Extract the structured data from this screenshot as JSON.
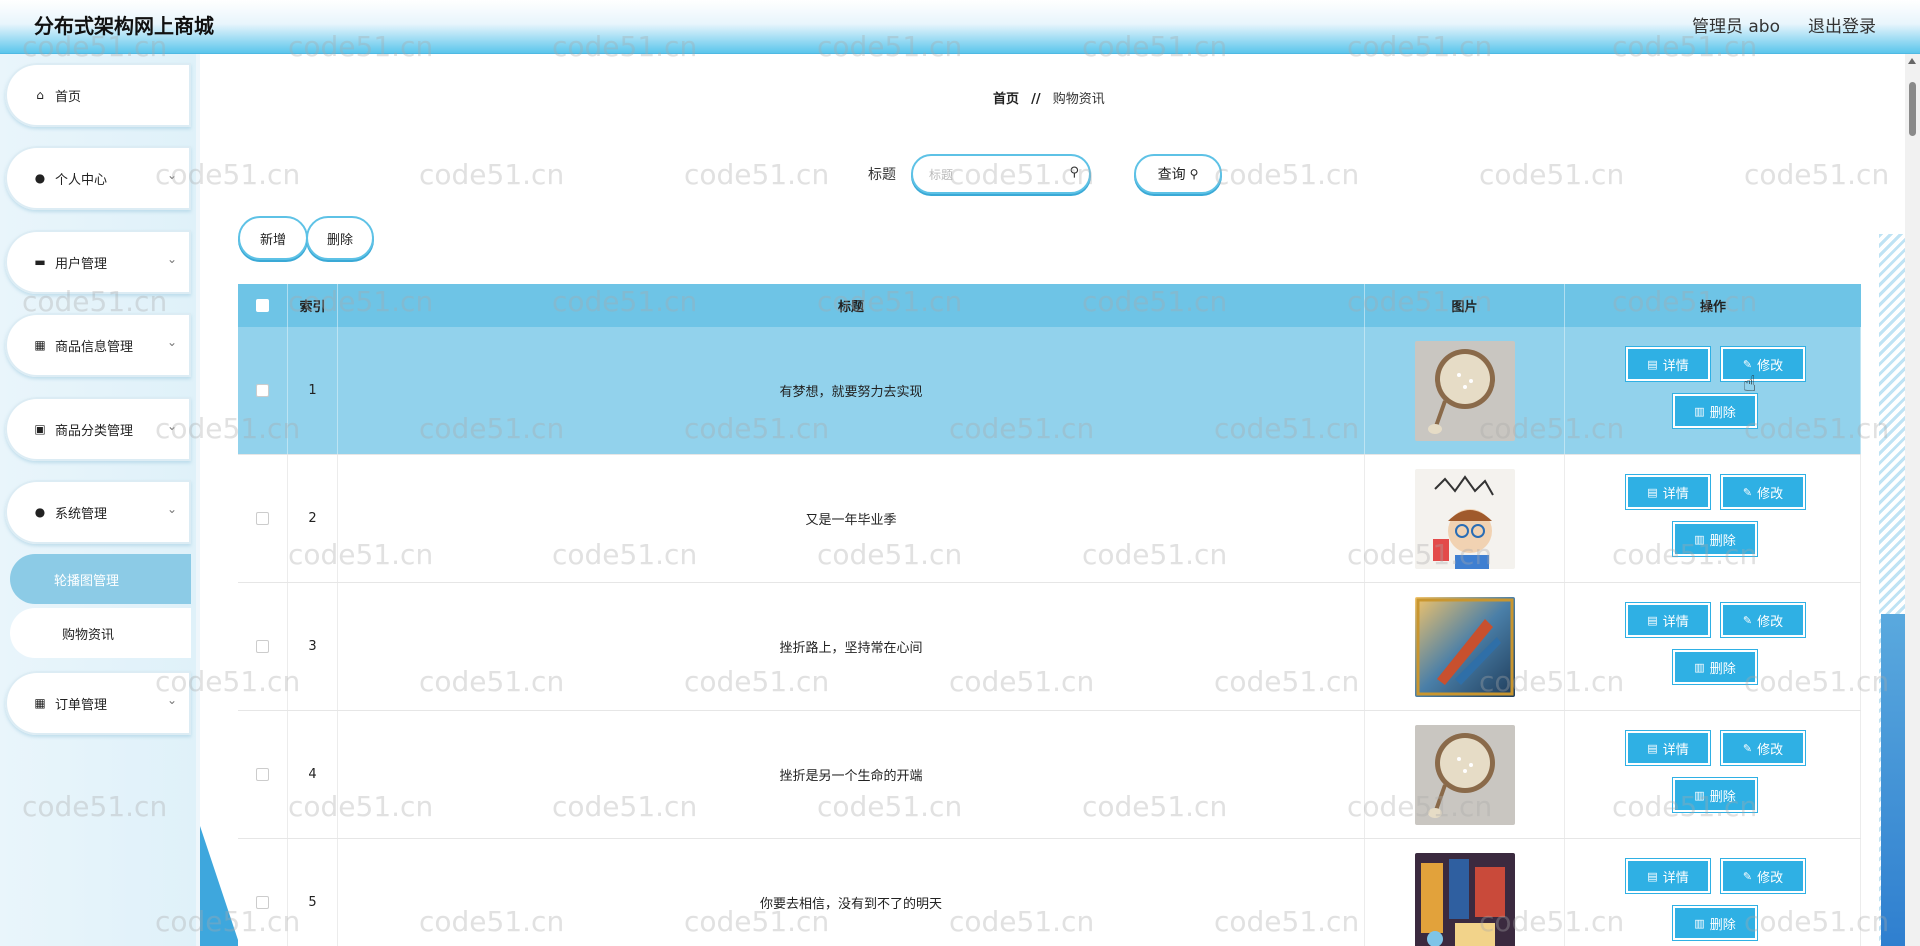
{
  "app": {
    "title": "分布式架构网上商城",
    "user": "管理员 abo",
    "logout": "退出登录"
  },
  "sidebar": {
    "items": [
      {
        "label": "首页",
        "icon": "home-icon",
        "glyph": "⌂"
      },
      {
        "label": "个人中心",
        "icon": "person-icon",
        "glyph": "●"
      },
      {
        "label": "用户管理",
        "icon": "user-manage-icon",
        "glyph": "▬"
      },
      {
        "label": "商品信息管理",
        "icon": "grid-icon",
        "glyph": "▦"
      },
      {
        "label": "商品分类管理",
        "icon": "clipboard-icon",
        "glyph": "▣"
      },
      {
        "label": "系统管理",
        "icon": "person-icon",
        "glyph": "●"
      },
      {
        "label": "订单管理",
        "icon": "grid-icon",
        "glyph": "▦"
      }
    ],
    "subitems": [
      "轮播图管理",
      "购物资讯"
    ]
  },
  "breadcrumb": {
    "home": "首页",
    "sep": "//",
    "current": "购物资讯"
  },
  "search": {
    "label": "标题",
    "placeholder": "标题",
    "query_label": "查询"
  },
  "actions": {
    "add": "新增",
    "delete": "删除"
  },
  "table": {
    "headers": {
      "index": "索引",
      "title": "标题",
      "image": "图片",
      "ops": "操作"
    },
    "rows": [
      {
        "index": "1",
        "title": "有梦想，就要努力去实现",
        "image": "rice-bowl-image"
      },
      {
        "index": "2",
        "title": "又是一年毕业季",
        "image": "cartoon-student-image"
      },
      {
        "index": "3",
        "title": "挫折路上，坚持常在心间",
        "image": "kayak-image"
      },
      {
        "index": "4",
        "title": "挫折是另一个生命的开端",
        "image": "rice-bowl-image"
      },
      {
        "index": "5",
        "title": "你要去相信，没有到不了的明天",
        "image": "street-scene-image"
      }
    ],
    "op_labels": {
      "detail": "详情",
      "edit": "修改",
      "delete": "删除"
    }
  },
  "watermark": "code51.cn",
  "colors": {
    "accent": "#2fb0e4",
    "header": "#6ec4e6",
    "highlight": "#92d2ec"
  }
}
